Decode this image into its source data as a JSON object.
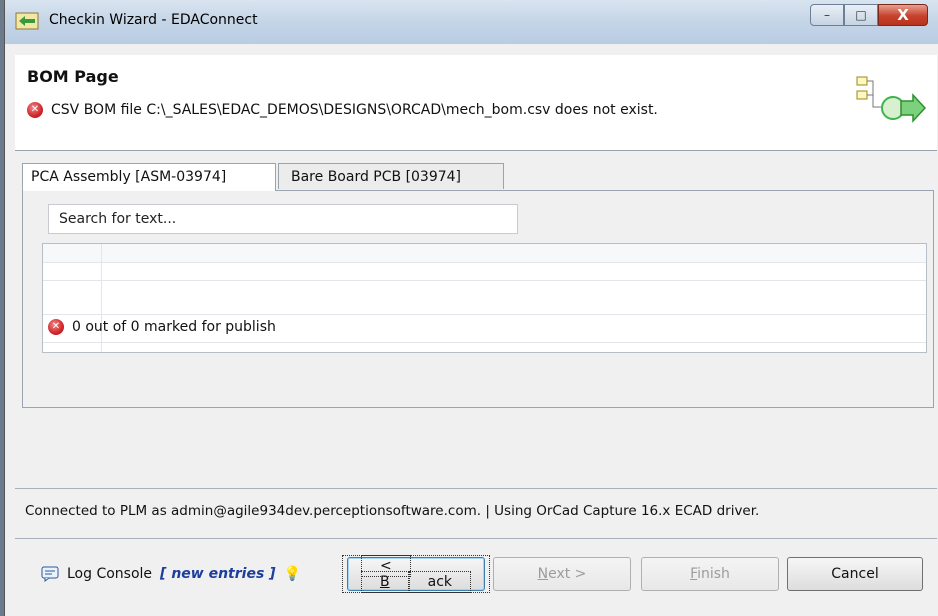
{
  "window": {
    "title": "Checkin Wizard - EDAConnect",
    "minimize_label": "–",
    "maximize_label": "□",
    "close_label": "X"
  },
  "header": {
    "title": "BOM Page",
    "error_message": "CSV BOM file C:\\_SALES\\EDAC_DEMOS\\DESIGNS\\ORCAD\\mech_bom.csv does not exist."
  },
  "tabs": [
    {
      "label": "PCA Assembly [ASM-03974]",
      "active": true
    },
    {
      "label": "Bare Board PCB [03974]",
      "active": false
    }
  ],
  "search": {
    "placeholder": "Search for text..."
  },
  "status": {
    "publish_text": "0 out of 0 marked for publish",
    "icon": "error-icon"
  },
  "footer": {
    "connection_text": "Connected to PLM as admin@agile934dev.perceptionsoftware.com. | Using OrCad Capture 16.x ECAD driver.",
    "log_console_label": "Log Console",
    "new_entries_label": "[ new entries ]"
  },
  "buttons": {
    "back": {
      "prefix": "< ",
      "mnemonic": "B",
      "rest": "ack"
    },
    "next": {
      "mnemonic": "N",
      "rest": "ext >"
    },
    "finish": {
      "mnemonic": "F",
      "rest": "inish"
    },
    "cancel": "Cancel"
  },
  "colors": {
    "error_red": "#d0262a",
    "link_blue": "#1c3e9c",
    "wizard_green": "#3cb44a"
  }
}
